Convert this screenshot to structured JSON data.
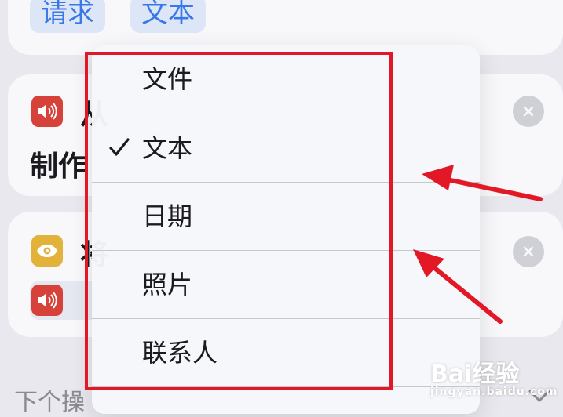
{
  "top_card": {
    "chips": [
      "请求",
      "文本"
    ]
  },
  "speak_card": {
    "line1": "从",
    "line2": "制作"
  },
  "show_card": {
    "line1": "将"
  },
  "menu": {
    "items": [
      {
        "label": "文件",
        "checked": false
      },
      {
        "label": "文本",
        "checked": true
      },
      {
        "label": "日期",
        "checked": false
      },
      {
        "label": "照片",
        "checked": false
      },
      {
        "label": "联系人",
        "checked": false
      }
    ]
  },
  "bottom": {
    "next_action_label": "下个操"
  },
  "watermark": {
    "brand": "Bai经验",
    "url": "jingyan.baidu.com"
  },
  "colors": {
    "accent": "#3b78e7",
    "highlight": "#e31826",
    "speaker_icon_bg": "#d6423a",
    "eye_icon_bg": "#e2b23a"
  },
  "icons": [
    "speaker-icon",
    "eye-icon",
    "close-icon",
    "checkmark-icon",
    "chevron-down-icon"
  ]
}
